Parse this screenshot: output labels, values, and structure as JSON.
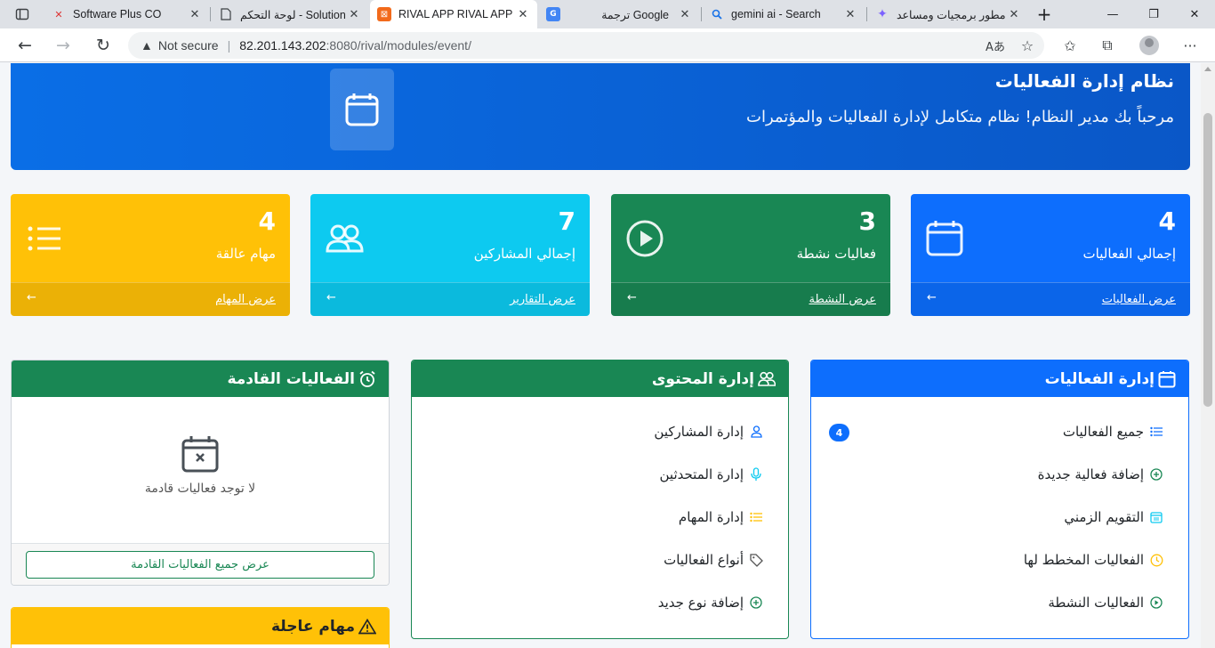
{
  "browser": {
    "tabs": [
      {
        "label": "Software Plus CO",
        "icon": "software-plus-favicon"
      },
      {
        "label": "لوحة التحكم - Solutions",
        "icon": "page-icon"
      },
      {
        "label": "RIVAL APP RIVAL APP",
        "icon": "rival-favicon"
      },
      {
        "label": "ترجمة Google",
        "icon": "google-translate-icon"
      },
      {
        "label": "gemini ai - Search",
        "icon": "search-icon"
      },
      {
        "label": "مطور برمجيات ومساعد",
        "icon": "gemini-icon"
      }
    ],
    "address": {
      "security": "Not secure",
      "host": "82.201.143.202",
      "path": ":8080/rival/modules/event/"
    }
  },
  "hero": {
    "title": "نظام إدارة الفعاليات",
    "subtitle": "مرحباً بك مدير النظام! نظام متكامل لإدارة الفعاليات والمؤتمرات"
  },
  "stats": [
    {
      "value": "4",
      "label": "إجمالي الفعاليات",
      "link": "عرض الفعاليات",
      "color": "#0d6efd",
      "icon": "calendar-icon"
    },
    {
      "value": "3",
      "label": "فعاليات نشطة",
      "link": "عرض النشطة",
      "color": "#198754",
      "icon": "play-circle-icon"
    },
    {
      "value": "7",
      "label": "إجمالي المشاركين",
      "link": "عرض التقارير",
      "color": "#0dcaf0",
      "icon": "people-icon"
    },
    {
      "value": "4",
      "label": "مهام عالقة",
      "link": "عرض المهام",
      "color": "#ffc107",
      "icon": "list-icon"
    }
  ],
  "events_card": {
    "title": "إدارة الفعاليات",
    "items": [
      {
        "label": "جميع الفعاليات",
        "badge": "4",
        "icon": "list-icon"
      },
      {
        "label": "إضافة فعالية جديدة",
        "icon": "plus-circle-icon"
      },
      {
        "label": "التقويم الزمني",
        "icon": "calendar-date-icon"
      },
      {
        "label": "الفعاليات المخطط لها",
        "icon": "clock-icon"
      },
      {
        "label": "الفعاليات النشطة",
        "icon": "play-circle-icon"
      }
    ]
  },
  "content_card": {
    "title": "إدارة المحتوى",
    "items": [
      {
        "label": "إدارة المشاركين",
        "icon": "person-icon"
      },
      {
        "label": "إدارة المتحدثين",
        "icon": "microphone-icon"
      },
      {
        "label": "إدارة المهام",
        "icon": "tasks-icon"
      },
      {
        "label": "أنواع الفعاليات",
        "icon": "tag-icon"
      },
      {
        "label": "إضافة نوع جديد",
        "icon": "plus-circle-icon"
      }
    ]
  },
  "upcoming_card": {
    "title": "الفعاليات القادمة",
    "empty_text": "لا توجد فعاليات قادمة",
    "button": "عرض جميع الفعاليات القادمة"
  },
  "urgent_card": {
    "title": "مهام عاجلة"
  },
  "colors": {
    "primary": "#0d6efd",
    "success": "#198754",
    "info": "#0dcaf0",
    "warning": "#ffc107"
  }
}
